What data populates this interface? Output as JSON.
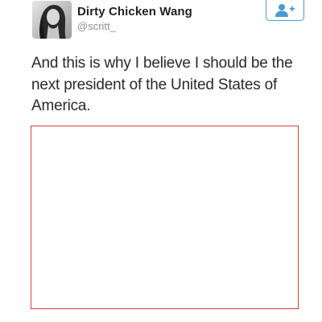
{
  "tweet": {
    "author": {
      "display_name": "Dirty Chicken Wang",
      "handle": "@scritt_",
      "avatar_icon": "profile-photo"
    },
    "follow_button": {
      "icon": "add-user-icon",
      "color": "#4a9ad8"
    },
    "text": "And this is why I believe I should be the next president of the United States of America.",
    "media": {
      "border_color": "#d23c3c"
    }
  }
}
